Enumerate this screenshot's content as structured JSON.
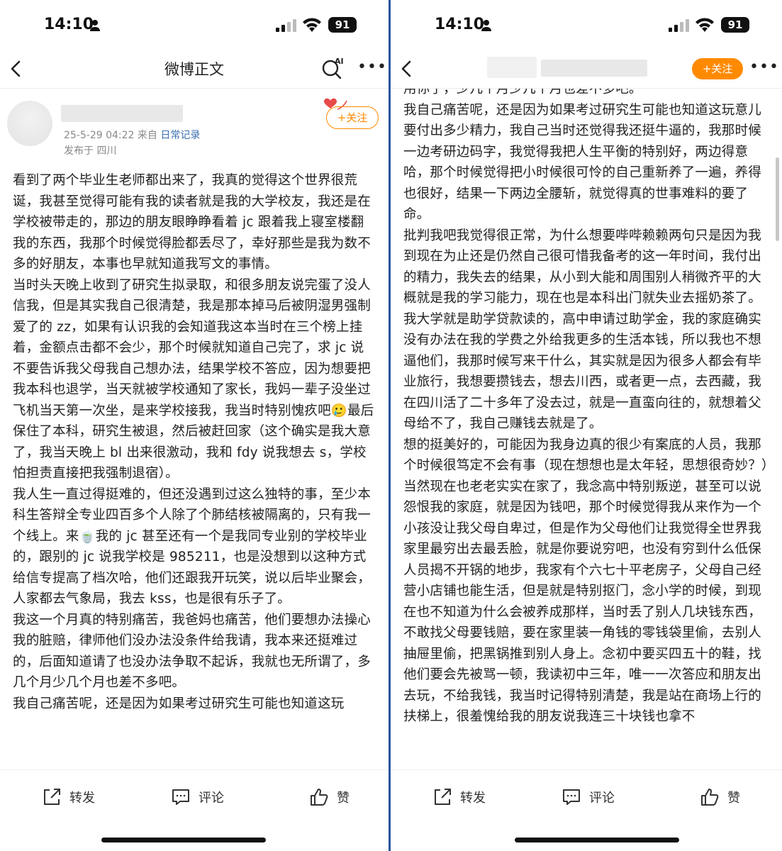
{
  "left": {
    "status": {
      "time": "14:10",
      "battery": "91"
    },
    "nav": {
      "title": "微博正文",
      "follow": "+关注"
    },
    "post": {
      "date": "25-5-29 04:22",
      "via": "来自",
      "source": "日常记录",
      "location": "发布于 四川"
    },
    "paragraphs": [
      "看到了两个毕业生老师都出来了，我真的觉得这个世界很荒诞，我甚至觉得可能有我的读者就是我的大学校友，我还是在学校被带走的，那边的朋友眼睁睁看着 jc 跟着我上寝室楼翻我的东西，我那个时候觉得脸都丢尽了，幸好那些是我为数不多的好朋友，本事也早就知道我写文的事情。",
      "当时头天晚上收到了研究生拟录取，和很多朋友说完蛋了没人信我，但是其实我自己很清楚，我是那本掉马后被阴湿男强制爱了的 zz，如果有认识我的会知道我这本当时在三个榜上挂着，金额点击都不会少，那个时候就知道自己完了，求 jc 说不要告诉我父母我自己想办法，结果学校不答应，因为想要把我本科也退学，当天就被学校通知了家长，我妈一辈子没坐过飞机当天第一次坐，是来学校接我，我当时特别愧疚吧🥲最后保住了本科，研究生被退，然后被赶回家（这个确实是我大意了，我当天晚上 bl 出来很激动，我和 fdy 说我想去 s，学校怕担责直接把我强制退宿）。",
      "我人生一直过得挺难的，但还没遇到过这么独特的事，至少本科生答辩全专业四百多个人除了个肺结核被隔离的，只有我一个线上。来🍵我的 jc 甚至还有一个是我同专业别的学校毕业的，跟别的 jc 说我学校是 985211，也是没想到以这种方式给信专提高了档次哈，他们还跟我开玩笑，说以后毕业聚会，人家都去气象局，我去 kss，也是很有乐子了。",
      "我这一个月真的特别痛苦，我爸妈也痛苦，他们要想办法操心我的脏赔，律师他们没办法没条件给我请，我本来还挺难过的，后面知道请了也没办法争取不起诉，我就也无所谓了，多几个月少几个月也差不多吧。",
      "我自己痛苦呢，还是因为如果考过研究生可能也知道这玩"
    ],
    "actions": {
      "share": "转发",
      "comment": "评论",
      "like": "赞"
    }
  },
  "right": {
    "status": {
      "time": "14:10",
      "battery": "91"
    },
    "nav": {
      "follow": "+关注"
    },
    "paragraphs": [
      "用你了，少几个月少几个月也差不多吧。",
      "我自己痛苦呢，还是因为如果考过研究生可能也知道这玩意儿要付出多少精力，我自己当时还觉得我还挺牛逼的，我那时候一边考研边码字，我觉得我把人生平衡的特别好，两边得意哈，那个时候觉得把小时候很可怜的自己重新养了一遍，养得也很好，结果一下两边全腰斩，就觉得真的世事难料的要了命。",
      "批判我吧我觉得很正常，为什么想要哔哔赖赖两句只是因为我到现在为止还是仍然自己很可惜我备考的这一年时间，我付出的精力，我失去的结果，从小到大能和周围别人稍微齐平的大概就是我的学习能力，现在也是本科出门就失业去摇奶茶了。",
      "我大学就是助学贷款读的，高中申请过助学金，我的家庭确实没有办法在我的学费之外给我更多的生活本钱，所以我也不想逼他们，我那时候写来干什么，其实就是因为很多人都会有毕业旅行，我想要攒钱去，想去川西，或者更一点，去西藏，我在四川活了二十多年了没去过，就是一直蛮向往的，就想着父母给不了，我自己赚钱去就是了。",
      "想的挺美好的，可能因为我身边真的很少有案底的人员，我那个时候很笃定不会有事（现在想想也是太年轻，思想很奇妙？）当然现在也老老实实在家了，我念高中特别叛逆，甚至可以说怨恨我的家庭，就是因为钱吧，那个时候觉得我从来作为一个小孩没让我父母自卑过，但是作为父母他们让我觉得全世界我家里最穷出去最丢脸，就是你要说穷吧，也没有穷到什么低保人员揭不开锅的地步，我家有个六七十平老房子，父母自己经营小店铺也能生活，但是就是特别抠门，念小学的时候，到现在也不知道为什么会被养成那样，当时丢了别人几块钱东西，不敢找父母要钱赔，要在家里装一角钱的零钱袋里偷，去别人抽屉里偷，把黑锅推到别人身上。念初中要买四五十的鞋，找他们要会先被骂一顿，我读初中三年，唯一一次答应和朋友出去玩，不给我钱，我当时记得特别清楚，我是站在商场上行的扶梯上，很羞愧给我的朋友说我连三十块钱也拿不"
    ],
    "actions": {
      "share": "转发",
      "comment": "评论",
      "like": "赞"
    }
  }
}
